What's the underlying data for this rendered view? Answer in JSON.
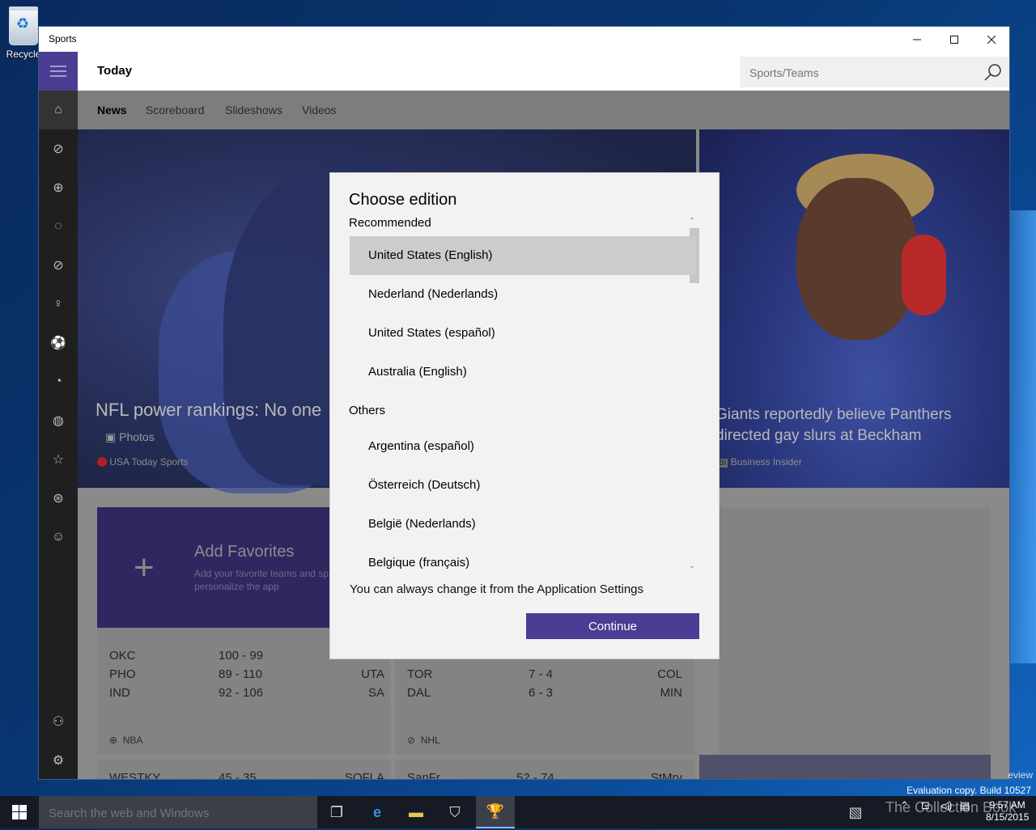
{
  "desktop": {
    "recycle_bin_label": "Recycle"
  },
  "window": {
    "title": "Sports"
  },
  "appbar": {
    "page_title": "Today",
    "search_placeholder": "Sports/Teams"
  },
  "tabs": [
    "News",
    "Scoreboard",
    "Slideshows",
    "Videos"
  ],
  "rail_icons": [
    "home-icon",
    "football-icon",
    "basketball-icon",
    "baseball-icon",
    "hockey-icon",
    "golf-icon",
    "soccer-icon",
    "racing-icon",
    "tennis-icon",
    "favorites-icon",
    "olympics-icon",
    "fun-icon"
  ],
  "hero": {
    "left_title": "NFL power rankings: No one",
    "left_badge": "Photos",
    "left_source": "USA Today Sports",
    "right_title_line1": "Giants reportedly believe Panthers",
    "right_title_line2": "directed gay slurs at Beckham",
    "right_source": "Business Insider",
    "right_source_badge": "BI"
  },
  "favorites": {
    "title": "Add Favorites",
    "desc": "Add your favorite teams and sp",
    "desc2": "personalize the app"
  },
  "nba": {
    "rows": [
      {
        "t1": "OKC",
        "score": "100  -  99",
        "t2": ""
      },
      {
        "t1": "PHO",
        "score": "89  -  110",
        "t2": "UTA"
      },
      {
        "t1": "IND",
        "score": "92  -  106",
        "t2": "SA"
      }
    ],
    "league": "NBA"
  },
  "nhl": {
    "rows": [
      {
        "t1": "TOR",
        "score": "7  -  4",
        "t2": "COL"
      },
      {
        "t1": "DAL",
        "score": "6  -  3",
        "t2": "MIN"
      }
    ],
    "league": "NHL"
  },
  "bottom_rows": [
    {
      "t1": "WESTKY",
      "score": "45  -  35",
      "t2": "SOFLA"
    },
    {
      "t1": "SanFr",
      "score": "52  -  74",
      "t2": "StMry"
    }
  ],
  "dialog": {
    "title": "Choose edition",
    "recommended_header": "Recommended",
    "recommended": [
      "United States (English)",
      "Nederland (Nederlands)",
      "United States (español)",
      "Australia (English)"
    ],
    "others_header": "Others",
    "others": [
      "Argentina (español)",
      "Österreich (Deutsch)",
      "België (Nederlands)",
      "Belgique (français)"
    ],
    "note": "You can always change it from the Application Settings",
    "continue_label": "Continue"
  },
  "taskbar": {
    "search_placeholder": "Search the web and Windows",
    "time": "9:57 AM",
    "date": "8/15/2015",
    "eval_text": "Evaluation copy. Build 10527",
    "eval_partial": "eview",
    "watermark": "The Collection Book"
  }
}
